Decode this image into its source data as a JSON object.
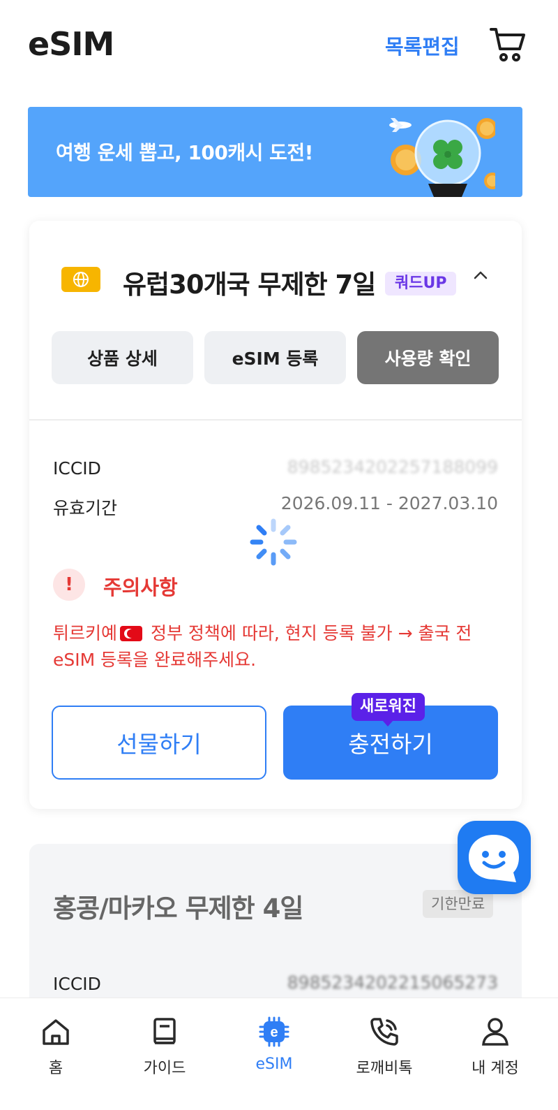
{
  "header": {
    "title": "eSIM",
    "edit_label": "목록편집",
    "cart_icon": "cart-icon"
  },
  "banner": {
    "text": "여행 운세 뽑고, 100캐시 도전!"
  },
  "card1": {
    "title": "유럽30개국 무제한 7일",
    "badge": "쿼드UP",
    "tabs": [
      {
        "label": "상품 상세"
      },
      {
        "label": "eSIM 등록"
      },
      {
        "label": "사용량 확인"
      }
    ],
    "iccid_label": "ICCID",
    "iccid_value": "8985234202257188099",
    "validity_label": "유효기간",
    "validity_value": "2026.09.11 - 2027.03.10",
    "warning_title": "주의사항",
    "warning_text_before": "튀르키예",
    "warning_text_after": " 정부 정책에 따라, 현지 등록 불가 → 출국 전 eSIM 등록을 완료해주세요.",
    "gift_label": "선물하기",
    "charge_label": "충전하기",
    "new_tip": "새로워진"
  },
  "card2": {
    "title": "홍콩/마카오 무제한 4일",
    "badge": "기한만료",
    "iccid_label": "ICCID",
    "iccid_value": "8985234202215065273"
  },
  "bottom_nav": [
    {
      "label": "홈",
      "icon": "home-icon"
    },
    {
      "label": "가이드",
      "icon": "book-icon"
    },
    {
      "label": "eSIM",
      "icon": "esim-chip-icon"
    },
    {
      "label": "로깨비톡",
      "icon": "phone-icon"
    },
    {
      "label": "내 계정",
      "icon": "person-icon"
    }
  ],
  "colors": {
    "primary": "#2f7ef5",
    "banner": "#54a4fb",
    "warning": "#e53935",
    "badge_purple": "#6a37e6"
  }
}
